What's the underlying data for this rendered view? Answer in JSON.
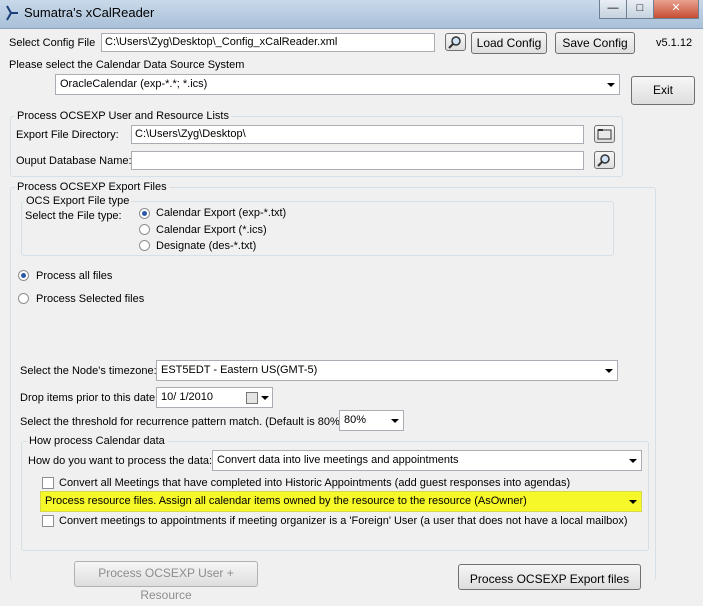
{
  "window": {
    "title": "Sumatra's xCalReader",
    "version": "v5.1.12"
  },
  "config": {
    "label": "Select Config File",
    "path": "C:\\Users\\Zyg\\Desktop\\_Config_xCalReader.xml",
    "load_label": "Load Config",
    "save_label": "Save Config"
  },
  "source": {
    "label": "Please select the Calendar Data Source System",
    "selected": "OracleCalendar (exp-*.*; *.ics)"
  },
  "exit_label": "Exit",
  "user_lists": {
    "legend": "Process OCSEXP User and Resource Lists",
    "export_dir_label": "Export File Directory:",
    "export_dir_value": "C:\\Users\\Zyg\\Desktop\\",
    "db_name_label": "Ouput Database Name:",
    "db_name_value": ""
  },
  "export_files": {
    "legend": "Process OCSEXP Export Files",
    "file_type_legend": "OCS Export File type",
    "select_type_label": "Select the File type:",
    "file_types": [
      "Calendar Export (exp-*.txt)",
      "Calendar Export (*.ics)",
      "Designate (des-*.txt)"
    ],
    "process_all": "Process all files",
    "process_selected": "Process Selected files",
    "timezone_label": "Select the Node's timezone:",
    "timezone_value": "EST5EDT - Eastern US(GMT-5)",
    "drop_label": "Drop items prior to this date",
    "drop_date": "10/  1/2010",
    "threshold_label": "Select the threshold for recurrence pattern match. (Default is 80%).",
    "threshold_value": "80%"
  },
  "calendar_data": {
    "legend": "How process Calendar data",
    "how_label": "How do you want to process the data:",
    "how_value": "Convert data into live meetings and appointments",
    "convert_meetings": "Convert all Meetings that have completed into Historic Appointments (add guest responses into agendas)",
    "resource_value": "Process resource files. Assign all calendar items owned by the resource to the resource (AsOwner)",
    "convert_foreign": "Convert meetings to appointments if meeting organizer is a 'Foreign' User (a user that does not have a local mailbox)"
  },
  "buttons": {
    "process_user": "Process OCSEXP User + Resource",
    "process_export": "Process OCSEXP Export files"
  },
  "colors": {
    "highlight": "#f6f82a",
    "window_bg": "#f0f0f0"
  }
}
